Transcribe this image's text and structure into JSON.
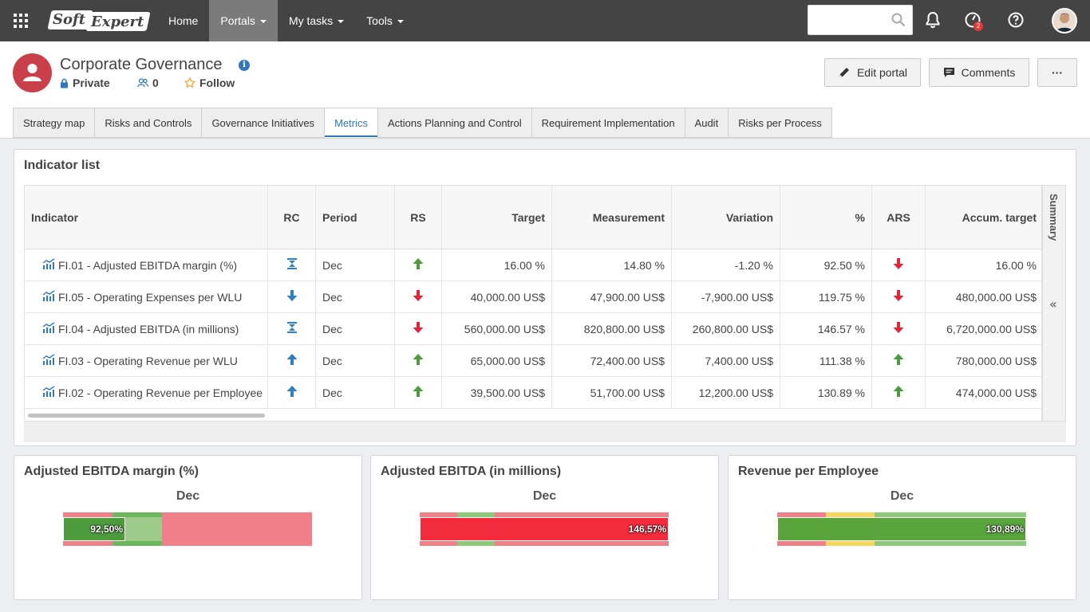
{
  "topbar": {
    "logo_part1": "Soft",
    "logo_part2": "Expert",
    "nav": [
      {
        "label": "Home",
        "caret": false
      },
      {
        "label": "Portals",
        "caret": true
      },
      {
        "label": "My tasks",
        "caret": true
      },
      {
        "label": "Tools",
        "caret": true
      }
    ],
    "search_placeholder": "",
    "notification_badge": "2"
  },
  "portal": {
    "title": "Corporate Governance",
    "info_glyph": "i",
    "privacy": "Private",
    "members": "0",
    "follow": "Follow",
    "edit_label": "Edit portal",
    "comments_label": "Comments",
    "more_label": "···"
  },
  "tabs": [
    {
      "label": "Strategy map"
    },
    {
      "label": "Risks and Controls"
    },
    {
      "label": "Governance Initiatives"
    },
    {
      "label": "Metrics",
      "active": true
    },
    {
      "label": "Actions Planning and Control"
    },
    {
      "label": "Requirement Implementation"
    },
    {
      "label": "Audit"
    },
    {
      "label": "Risks per Process"
    }
  ],
  "indicator_list": {
    "title": "Indicator list",
    "summary_label": "Summary",
    "collapse_glyph": "«",
    "columns": [
      "Indicator",
      "RC",
      "Period",
      "RS",
      "Target",
      "Measurement",
      "Variation",
      "%",
      "ARS",
      "Accum. target"
    ],
    "rows": [
      {
        "indicator": "FI.01 - Adjusted EBITDA margin (%)",
        "rc": "target",
        "period": "Dec",
        "rs": "up-green",
        "target": "16.00 %",
        "measurement": "14.80 %",
        "variation": "-1.20 %",
        "pct": "92.50 %",
        "ars": "down-red",
        "accum_target": "16.00 %"
      },
      {
        "indicator": "FI.05 - Operating Expenses per WLU",
        "rc": "down",
        "period": "Dec",
        "rs": "down-red",
        "target": "40,000.00 US$",
        "measurement": "47,900.00 US$",
        "variation": "-7,900.00 US$",
        "pct": "119.75 %",
        "ars": "down-red",
        "accum_target": "480,000.00 US$"
      },
      {
        "indicator": "FI.04 - Adjusted EBITDA (in millions)",
        "rc": "target",
        "period": "Dec",
        "rs": "down-red",
        "target": "560,000.00 US$",
        "measurement": "820,800.00 US$",
        "variation": "260,800.00 US$",
        "pct": "146.57 %",
        "ars": "down-red",
        "accum_target": "6,720,000.00 US$"
      },
      {
        "indicator": "FI.03 - Operating Revenue per WLU",
        "rc": "up",
        "period": "Dec",
        "rs": "up-green",
        "target": "65,000.00 US$",
        "measurement": "72,400.00 US$",
        "variation": "7,400.00 US$",
        "pct": "111.38 %",
        "ars": "up-green",
        "accum_target": "780,000.00 US$"
      },
      {
        "indicator": "FI.02 - Operating Revenue per Employee",
        "rc": "up",
        "period": "Dec",
        "rs": "up-green",
        "target": "39,500.00 US$",
        "measurement": "51,700.00 US$",
        "variation": "12,200.00 US$",
        "pct": "130.89 %",
        "ars": "up-green",
        "accum_target": "474,000.00 US$"
      }
    ]
  },
  "cards": [
    {
      "title": "Adjusted EBITDA margin (%)",
      "period": "Dec",
      "value_label": "92,50%",
      "value": 92.5,
      "bands": [
        {
          "color": "#f07f8a"
        },
        {
          "color": "#6db85a"
        },
        {
          "color": "#f07f8a"
        }
      ],
      "bar_color": "#4e9b3e",
      "fill_color": "#9ecb8a"
    },
    {
      "title": "Adjusted EBITDA (in millions)",
      "period": "Dec",
      "value_label": "146,57%",
      "value": 146.57,
      "bands": [
        {
          "color": "#f07f8a"
        },
        {
          "color": "#8ec97a"
        },
        {
          "color": "#f07f8a"
        }
      ],
      "bar_color": "#f22b3d"
    },
    {
      "title": "Revenue per Employee",
      "period": "Dec",
      "value_label": "130,89%",
      "value": 130.89,
      "bands": [
        {
          "color": "#f07f8a"
        },
        {
          "color": "#f5d65a"
        },
        {
          "color": "#8ec97a"
        }
      ],
      "bar_color": "#5aa43d"
    }
  ],
  "colors": {
    "topbar": "#444444",
    "accent": "#3277b8",
    "green": "#4e9b3e",
    "red": "#e0263a"
  }
}
